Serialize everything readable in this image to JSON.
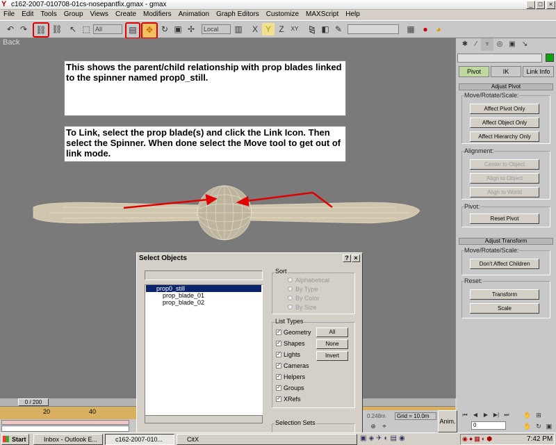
{
  "window": {
    "title": "c162-2007-010708-01cs-nosepantfix.gmax - gmax"
  },
  "menu": [
    "File",
    "Edit",
    "Tools",
    "Group",
    "Views",
    "Create",
    "Modifiers",
    "Animation",
    "Graph Editors",
    "Customize",
    "MAXScript",
    "Help"
  ],
  "toolbar": {
    "selection_filter": "All",
    "ref_coord": "Local",
    "named_sel": ""
  },
  "viewport": {
    "label": "Back",
    "note1": "This shows the parent/child relationship with prop blades linked to the spinner named prop0_still.",
    "note2": "To Link, select the prop blade(s) and click the Link Icon. Then select the Spinner.  When done select the Move tool to get out of link mode."
  },
  "command_panel": {
    "tabs": [
      "Pivot",
      "IK",
      "Link Info"
    ],
    "adjust_pivot": {
      "header": "Adjust Pivot",
      "move_label": "Move/Rotate/Scale:",
      "buttons": [
        "Affect Pivot Only",
        "Affect Object Only",
        "Affect Hierarchy Only"
      ],
      "alignment_label": "Alignment:",
      "align_buttons": [
        "Center to Object",
        "Align to Object",
        "Align to World"
      ],
      "pivot_label": "Pivot:",
      "reset_pivot": "Reset Pivot"
    },
    "adjust_transform": {
      "header": "Adjust Transform",
      "move_label": "Move/Rotate/Scale:",
      "dont_affect": "Don't Affect Children",
      "reset_label": "Reset:",
      "transform": "Transform",
      "scale": "Scale"
    }
  },
  "dialog": {
    "title": "Select Objects",
    "items": [
      "prop0_still",
      "prop_blade_01",
      "prop_blade_02"
    ],
    "sort": {
      "label": "Sort",
      "options": [
        "Alphabetical",
        "By Type",
        "By Color",
        "By Size"
      ]
    },
    "list_types": {
      "label": "List Types",
      "types": [
        "Geometry",
        "Shapes",
        "Lights",
        "Cameras",
        "Helpers",
        "Groups",
        "XRefs"
      ],
      "all": "All",
      "none": "None",
      "invert": "Invert"
    },
    "selection_sets": "Selection Sets"
  },
  "timeline": {
    "frame": "0 / 200",
    "ticks": [
      "20",
      "40"
    ]
  },
  "status": {
    "grid": "Grid = 10.0m",
    "anim": "Anim.",
    "spinner": "0",
    "coord_partial": "0.248m"
  },
  "taskbar": {
    "start": "Start",
    "tasks": [
      "Inbox - Outlook E...",
      "c162-2007-010...",
      "CitX"
    ],
    "clock": "7:42 PM"
  }
}
